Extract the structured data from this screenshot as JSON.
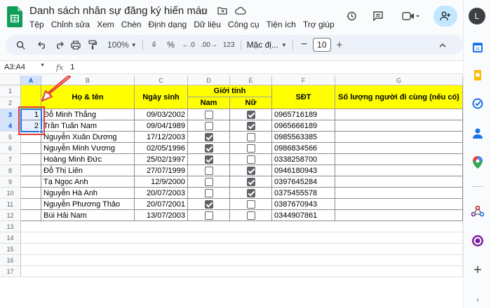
{
  "header": {
    "title": "Danh sách nhân sự đăng ký hiến máu",
    "menu": [
      "Tệp",
      "Chỉnh sửa",
      "Xem",
      "Chèn",
      "Định dạng",
      "Dữ liệu",
      "Công cụ",
      "Tiện ích",
      "Trợ giúp"
    ],
    "avatar_letter": "L"
  },
  "toolbar": {
    "zoom": "100%",
    "currency": "₫",
    "percent": "%",
    "dec_decrease": ".0",
    "dec_increase": ".00",
    "number_format": "123",
    "font": "Mặc đị...",
    "font_size": "10"
  },
  "formula_bar": {
    "name_box": "A3:A4",
    "fx": "fx",
    "value": "1"
  },
  "grid": {
    "columns": [
      "A",
      "B",
      "C",
      "D",
      "E",
      "F",
      "G"
    ],
    "row_numbers": [
      "1",
      "2",
      "3",
      "4",
      "5",
      "6",
      "7",
      "8",
      "9",
      "10",
      "11",
      "12",
      "13",
      "14",
      "15",
      "16",
      "17"
    ],
    "headers": {
      "name": "Họ & tên",
      "dob": "Ngày sinh",
      "gender": "Giới tính",
      "male": "Nam",
      "female": "Nữ",
      "phone": "SĐT",
      "companions": "Số lượng người đi cùng (nếu có)"
    },
    "rows": [
      {
        "stt": "1",
        "name": "Đỗ Minh Thắng",
        "dob": "09/03/2002",
        "male": false,
        "female": true,
        "phone": "0965716189"
      },
      {
        "stt": "2",
        "name": "Trần Tuấn Nam",
        "dob": "09/04/1989",
        "male": false,
        "female": true,
        "phone": "0965666189"
      },
      {
        "stt": "",
        "name": "Nguyễn Xuân Dương",
        "dob": "17/12/2003",
        "male": true,
        "female": false,
        "phone": "0985563385"
      },
      {
        "stt": "",
        "name": "Nguyễn Minh Vương",
        "dob": "02/05/1996",
        "male": true,
        "female": false,
        "phone": "0986834566"
      },
      {
        "stt": "",
        "name": "Hoàng Minh Đức",
        "dob": "25/02/1997",
        "male": true,
        "female": false,
        "phone": "0338258700"
      },
      {
        "stt": "",
        "name": "Đỗ Thị Liên",
        "dob": "27/07/1999",
        "male": false,
        "female": true,
        "phone": "0946180943"
      },
      {
        "stt": "",
        "name": "Tạ Ngọc Anh",
        "dob": "12/9/2000",
        "male": false,
        "female": true,
        "phone": "0397645284"
      },
      {
        "stt": "",
        "name": "Nguyễn Hà Anh",
        "dob": "20/07/2003",
        "male": false,
        "female": true,
        "phone": "0375455578"
      },
      {
        "stt": "",
        "name": "Nguyễn Phương Thảo",
        "dob": "20/07/2001",
        "male": true,
        "female": false,
        "phone": "0387670943"
      },
      {
        "stt": "",
        "name": "Bùi Hải Nam",
        "dob": "13/07/2003",
        "male": false,
        "female": false,
        "phone": "0344907861"
      }
    ]
  },
  "colors": {
    "header_fill": "#ffff00",
    "selection": "#1a73e8",
    "annotation": "#e53935"
  }
}
